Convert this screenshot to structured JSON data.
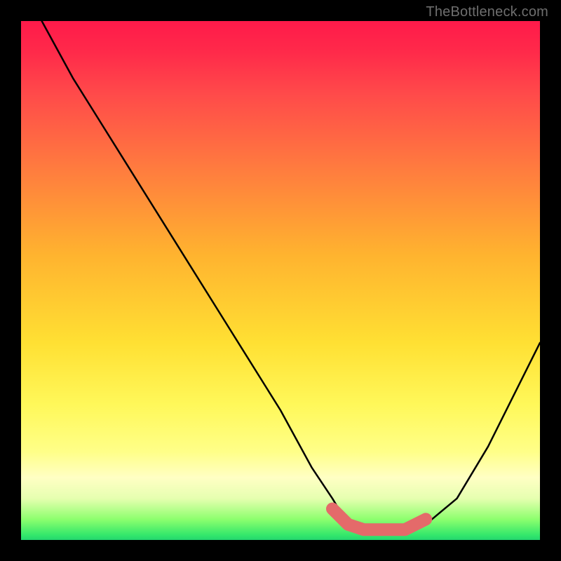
{
  "attribution": "TheBottleneck.com",
  "chart_data": {
    "type": "line",
    "title": "",
    "xlabel": "",
    "ylabel": "",
    "xlim": [
      0,
      100
    ],
    "ylim": [
      0,
      100
    ],
    "series": [
      {
        "name": "bottleneck-curve",
        "x": [
          4,
          10,
          20,
          30,
          40,
          50,
          56,
          60,
          63,
          66,
          70,
          74,
          78,
          84,
          90,
          100
        ],
        "values": [
          100,
          89,
          73,
          57,
          41,
          25,
          14,
          8,
          3,
          2,
          2,
          2,
          3,
          8,
          18,
          38
        ]
      }
    ],
    "highlight": {
      "name": "optimal-range",
      "x": [
        60,
        63,
        66,
        70,
        74,
        78
      ],
      "values": [
        6,
        3,
        2,
        2,
        2,
        4
      ]
    },
    "colors": {
      "curve": "#000000",
      "highlight": "#e46a6a"
    }
  }
}
